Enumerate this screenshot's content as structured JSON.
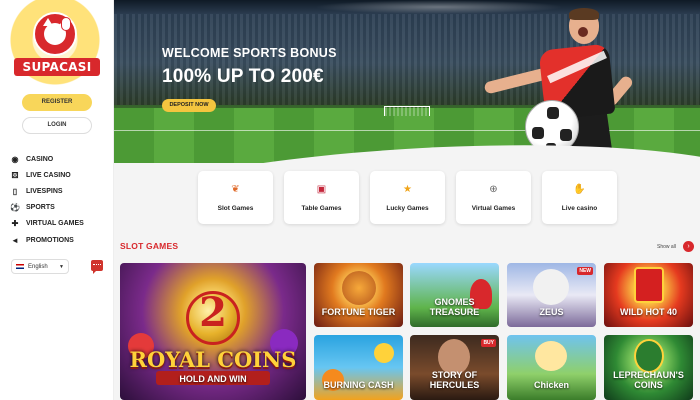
{
  "brand": {
    "name": "SUPACASI"
  },
  "auth": {
    "register_label": "REGISTER",
    "login_label": "LOGIN"
  },
  "nav": {
    "items": [
      {
        "label": "CASINO",
        "icon": "casino-chip-icon"
      },
      {
        "label": "LIVE CASINO",
        "icon": "dice-icon"
      },
      {
        "label": "LIVESPINS",
        "icon": "phone-icon"
      },
      {
        "label": "SPORTS",
        "icon": "football-icon"
      },
      {
        "label": "VIRTUAL GAMES",
        "icon": "gamepad-icon"
      },
      {
        "label": "PROMOTIONS",
        "icon": "megaphone-icon"
      }
    ]
  },
  "language": {
    "selected": "English"
  },
  "hero": {
    "kicker": "WELCOME SPORTS BONUS",
    "title": "100% UP TO 200€",
    "cta_label": "DEPOSIT NOW"
  },
  "categories": [
    {
      "label": "Slot Games",
      "icon": "slot-cherry-icon"
    },
    {
      "label": "Table Games",
      "icon": "cards-icon"
    },
    {
      "label": "Lucky Games",
      "icon": "star-icon"
    },
    {
      "label": "Virtual Games",
      "icon": "gamepad-icon"
    },
    {
      "label": "Live casino",
      "icon": "hand-icon"
    }
  ],
  "slot_section": {
    "title": "SLOT GAMES",
    "show_all": "Show all"
  },
  "games": {
    "featured": {
      "line1": "2",
      "line2": "ROYAL COINS",
      "line3": "HOLD AND WIN"
    },
    "tiles": [
      {
        "name": "FORTUNE TIGER"
      },
      {
        "name": "GNOMES TREASURE"
      },
      {
        "name": "ZEUS"
      },
      {
        "name": "WILD HOT 40"
      },
      {
        "name": "BURNING CASH"
      },
      {
        "name": "STORY OF HERCULES"
      },
      {
        "name": "Chicken"
      },
      {
        "name": "LEPRECHAUN'S COINS"
      }
    ]
  },
  "colors": {
    "accent": "#d8282c",
    "cta": "#f8d65a",
    "background": "#f4f4f4"
  }
}
